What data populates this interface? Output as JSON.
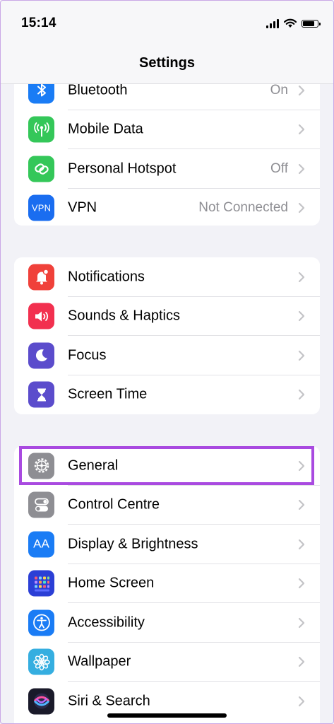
{
  "status_bar": {
    "time": "15:14"
  },
  "nav": {
    "title": "Settings"
  },
  "groups": [
    {
      "rows": [
        {
          "label": "Bluetooth",
          "value": "On",
          "icon": "bluetooth-icon",
          "color": "#1a7cf5"
        },
        {
          "label": "Mobile Data",
          "value": "",
          "icon": "antenna-icon",
          "color": "#34c759"
        },
        {
          "label": "Personal Hotspot",
          "value": "Off",
          "icon": "hotspot-chain-icon",
          "color": "#34c759"
        },
        {
          "label": "VPN",
          "value": "Not Connected",
          "icon": "vpn-icon",
          "icon_text": "VPN",
          "color": "#1a6df0"
        }
      ]
    },
    {
      "rows": [
        {
          "label": "Notifications",
          "value": "",
          "icon": "bell-icon",
          "color": "#f0413a"
        },
        {
          "label": "Sounds & Haptics",
          "value": "",
          "icon": "speaker-icon",
          "color": "#f2304f"
        },
        {
          "label": "Focus",
          "value": "",
          "icon": "moon-icon",
          "color": "#5b4ccc"
        },
        {
          "label": "Screen Time",
          "value": "",
          "icon": "hourglass-icon",
          "color": "#5b4ccc"
        }
      ]
    },
    {
      "rows": [
        {
          "label": "General",
          "value": "",
          "icon": "gear-icon",
          "color": "#8e8e93"
        },
        {
          "label": "Control Centre",
          "value": "",
          "icon": "toggles-icon",
          "color": "#8e8e93"
        },
        {
          "label": "Display & Brightness",
          "value": "",
          "icon": "text-size-icon",
          "icon_text": "AA",
          "color": "#1a7cf5"
        },
        {
          "label": "Home Screen",
          "value": "",
          "icon": "home-grid-icon",
          "color": "#2b3fd6"
        },
        {
          "label": "Accessibility",
          "value": "",
          "icon": "accessibility-icon",
          "color": "#1a7cf5"
        },
        {
          "label": "Wallpaper",
          "value": "",
          "icon": "flower-icon",
          "color": "#35aee0"
        },
        {
          "label": "Siri & Search",
          "value": "",
          "icon": "siri-icon",
          "color": "#1a1a2a"
        }
      ]
    }
  ],
  "highlight_color": "#a94ae0"
}
